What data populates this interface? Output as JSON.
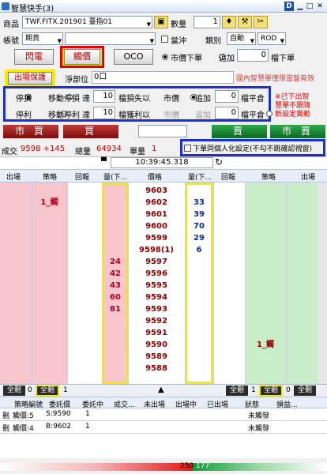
{
  "window": {
    "title": "智慧快手(3)"
  },
  "product": {
    "label": "商品",
    "value": "TWF.FITX.201901 臺指01",
    "qty_label": "數量",
    "qty_value": "1"
  },
  "account": {
    "label": "帳號",
    "type_value": "期貨",
    "account_value": "",
    "close_label": "當沖",
    "category_label": "類別",
    "category_value": "自動",
    "cond_value": "ROD"
  },
  "mode_buttons": {
    "flash": "閃電",
    "touch": "觸價",
    "oco": "OCO"
  },
  "order_type": {
    "market": "市價下單",
    "append": "追加",
    "lots_value": "0",
    "lots_suffix": "檔下單"
  },
  "protect": {
    "button": "出場保護",
    "net_label": "淨部位",
    "net_value": "0口",
    "notice": "國內智慧單僅限當盤有效"
  },
  "stop": {
    "row1": {
      "a": "停損",
      "b": "移動停損",
      "reach": "達",
      "value": "10",
      "unit": "檔損失以",
      "market": "市價",
      "append": "追加",
      "close_val": "0",
      "close": "檔平倉"
    },
    "row2": {
      "a": "停利",
      "b": "移動停利",
      "reach": "達",
      "value": "10",
      "unit": "檔獲利以",
      "market": "市價",
      "append": "追加",
      "close_val": "0",
      "close": "檔平倉"
    }
  },
  "note": {
    "line1": "※已下出智",
    "line2": "慧單不跟隨",
    "line3": "新設定異動"
  },
  "trade_buttons": {
    "market_buy": "市 買",
    "buy": "買",
    "sell": "賣",
    "market_sell": "市 賣"
  },
  "info": {
    "deal_label": "成交",
    "deal_value": "9598 +145",
    "vol_label": "總量",
    "vol_value": "64934",
    "unit_label": "單量",
    "unit_value": "1",
    "setting": "下單同個人化設定(不勾不跳確認視窗)"
  },
  "time": {
    "value": "10:39:45.318"
  },
  "grid_headers": [
    "出場",
    "策略",
    "回報",
    "量(下...",
    "價格",
    "量(下...",
    "回報",
    "策略",
    "出場"
  ],
  "ladder": [
    {
      "price": "9603",
      "bid": "",
      "ask": "",
      "left": "",
      "right": ""
    },
    {
      "price": "9602",
      "bid": "",
      "ask": "33",
      "left": "1_觸",
      "right": ""
    },
    {
      "price": "9601",
      "bid": "",
      "ask": "39",
      "left": "",
      "right": ""
    },
    {
      "price": "9600",
      "bid": "",
      "ask": "70",
      "left": "",
      "right": ""
    },
    {
      "price": "9599",
      "bid": "",
      "ask": "29",
      "left": "",
      "right": ""
    },
    {
      "price": "9598(1)",
      "bid": "",
      "ask": "6",
      "left": "",
      "right": ""
    },
    {
      "price": "9597",
      "bid": "24",
      "ask": "",
      "left": "",
      "right": ""
    },
    {
      "price": "9596",
      "bid": "42",
      "ask": "",
      "left": "",
      "right": ""
    },
    {
      "price": "9595",
      "bid": "43",
      "ask": "",
      "left": "",
      "right": ""
    },
    {
      "price": "9594",
      "bid": "60",
      "ask": "",
      "left": "",
      "right": ""
    },
    {
      "price": "9593",
      "bid": "81",
      "ask": "",
      "left": "",
      "right": ""
    },
    {
      "price": "9592",
      "bid": "",
      "ask": "",
      "left": "",
      "right": ""
    },
    {
      "price": "9591",
      "bid": "",
      "ask": "",
      "left": "",
      "right": ""
    },
    {
      "price": "9590",
      "bid": "",
      "ask": "",
      "left": "",
      "right": "1_觸"
    },
    {
      "price": "9589",
      "bid": "",
      "ask": "",
      "left": "",
      "right": ""
    },
    {
      "price": "9588",
      "bid": "",
      "ask": "",
      "left": "",
      "right": ""
    }
  ],
  "bottom_bar": {
    "all_left": "全刪",
    "left_val": "0",
    "del_left": "全刪",
    "left_val2": "1",
    "all_right": "全刪",
    "del_right": "全刪",
    "right_val": "0",
    "right_val2": "全刪"
  },
  "orders_header": [
    "策略編號",
    "委託價",
    "委託中",
    "成交...",
    "未出場",
    "出場中",
    "已出場",
    "狀態",
    "損益..."
  ],
  "orders": [
    {
      "act": "刪",
      "id": "觸價:5",
      "price": "S:9590",
      "qty": "1",
      "status": "未觸發"
    },
    {
      "act": "刪",
      "id": "觸價:4",
      "price": "B:9602",
      "qty": "1",
      "status": "未觸發"
    }
  ],
  "footer": {
    "left_val": "250",
    "right_val": "177"
  }
}
